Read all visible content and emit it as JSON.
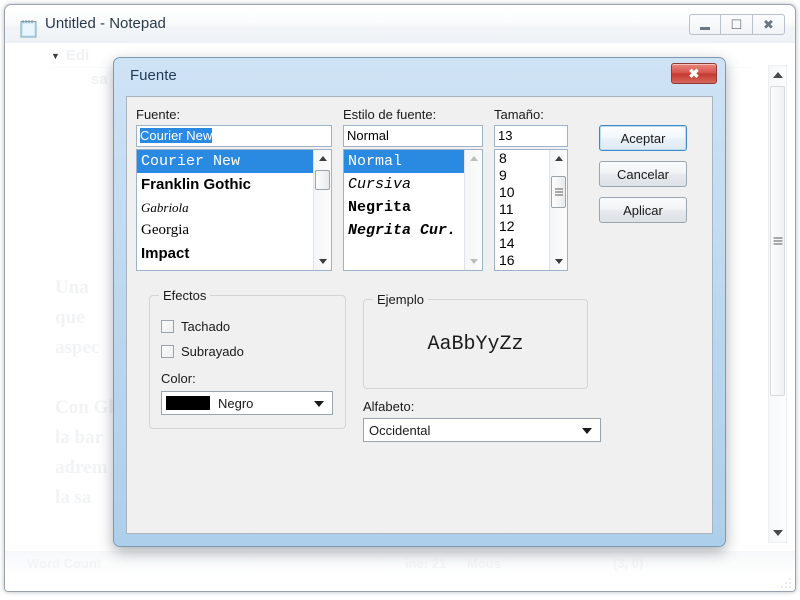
{
  "host_window": {
    "title": "Untitled - Notepad",
    "icon": "notepad-icon",
    "minimize_label": "–",
    "maximize_label": "▣",
    "close_label": "✕",
    "menu_item": "Edi",
    "menu_item_2": "sa",
    "document_text": "Una\nque\naspec\n\nCon Gl\nla bar\nadrem\nla sa",
    "status_bar": {
      "word_count": "Word Count",
      "line": "ine: 21",
      "mouse": "Mous",
      "coords": "(3, 0)"
    }
  },
  "dialog": {
    "title": "Fuente",
    "close_label": "✕",
    "font": {
      "label": "Fuente:",
      "value": "Courier New",
      "items": [
        {
          "name": "Courier New",
          "style": "mono",
          "selected": true
        },
        {
          "name": "Franklin Gothic",
          "style": "sans",
          "selected": false
        },
        {
          "name": "Gabriola",
          "style": "serif",
          "selected": false
        },
        {
          "name": "Georgia",
          "style": "serif",
          "selected": false
        },
        {
          "name": "Impact",
          "style": "sans",
          "selected": false
        }
      ]
    },
    "style": {
      "label": "Estilo de fuente:",
      "value": "Normal",
      "items": [
        {
          "name": "Normal",
          "selected": true
        },
        {
          "name": "Cursiva",
          "selected": false
        },
        {
          "name": "Negrita",
          "selected": false
        },
        {
          "name": "Negrita Cur.",
          "selected": false
        }
      ]
    },
    "size": {
      "label": "Tamaño:",
      "value": "13",
      "items": [
        "8",
        "9",
        "10",
        "11",
        "12",
        "14",
        "16"
      ]
    },
    "buttons": {
      "accept": "Aceptar",
      "cancel": "Cancelar",
      "apply": "Aplicar"
    },
    "effects": {
      "title": "Efectos",
      "strikeout": "Tachado",
      "underline": "Subrayado",
      "color_label": "Color:",
      "color_value": "Negro",
      "color_hex": "#000000"
    },
    "sample": {
      "title": "Ejemplo",
      "text": "AaBbYyZz"
    },
    "script": {
      "label": "Alfabeto:",
      "value": "Occidental"
    },
    "accent_hex": "#2a8ae2"
  }
}
